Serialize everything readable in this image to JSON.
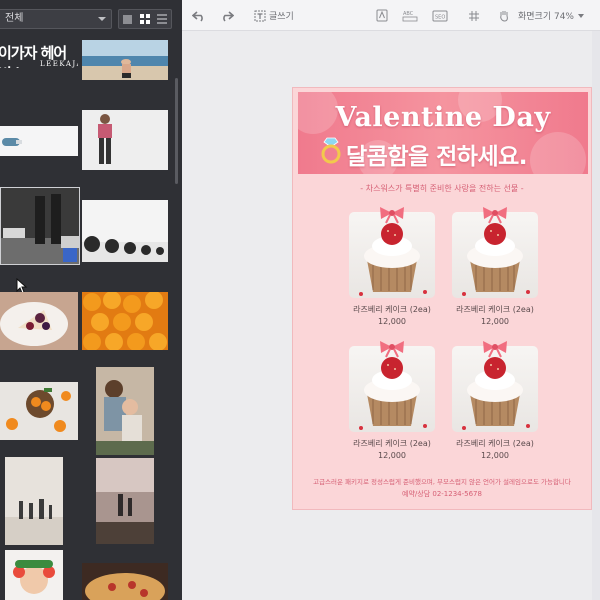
{
  "left_panel": {
    "filter_label": "전체",
    "thumb_headline_text": "이가자 헤어비스",
    "thumb_headline_sub": "LEEKAJA HAIRBIS"
  },
  "toolbar": {
    "undo_icon": "undo-icon",
    "redo_icon": "redo-icon",
    "text_label": "글쓰기",
    "zoom_label": "화면크기 74%"
  },
  "poster": {
    "title_en": "Valentine Day",
    "title_ko": "달콤함을 전하세요.",
    "subtitle": "- 차스워스가 특별히 준비한 사랑을 전하는 선물 -",
    "products": [
      {
        "name": "라즈베리 케이크 (2ea)",
        "price": "12,000"
      },
      {
        "name": "라즈베리 케이크 (2ea)",
        "price": "12,000"
      },
      {
        "name": "라즈베리 케이크 (2ea)",
        "price": "12,000"
      },
      {
        "name": "라즈베리 케이크 (2ea)",
        "price": "12,000"
      }
    ],
    "footer_note": "고급스러운 패키지로 정성스럽게 준비했으며, 부모스럽지 않은 언어가 설레임으로도 가능합니다",
    "footer_contact": "예약/상담 02-1234-5678"
  },
  "colors": {
    "panel_bg": "#2f3035",
    "canvas_bg": "#ececee",
    "poster_bg": "#fbd6d8",
    "banner": "#f07a8d",
    "accent_text": "#d65f74"
  }
}
